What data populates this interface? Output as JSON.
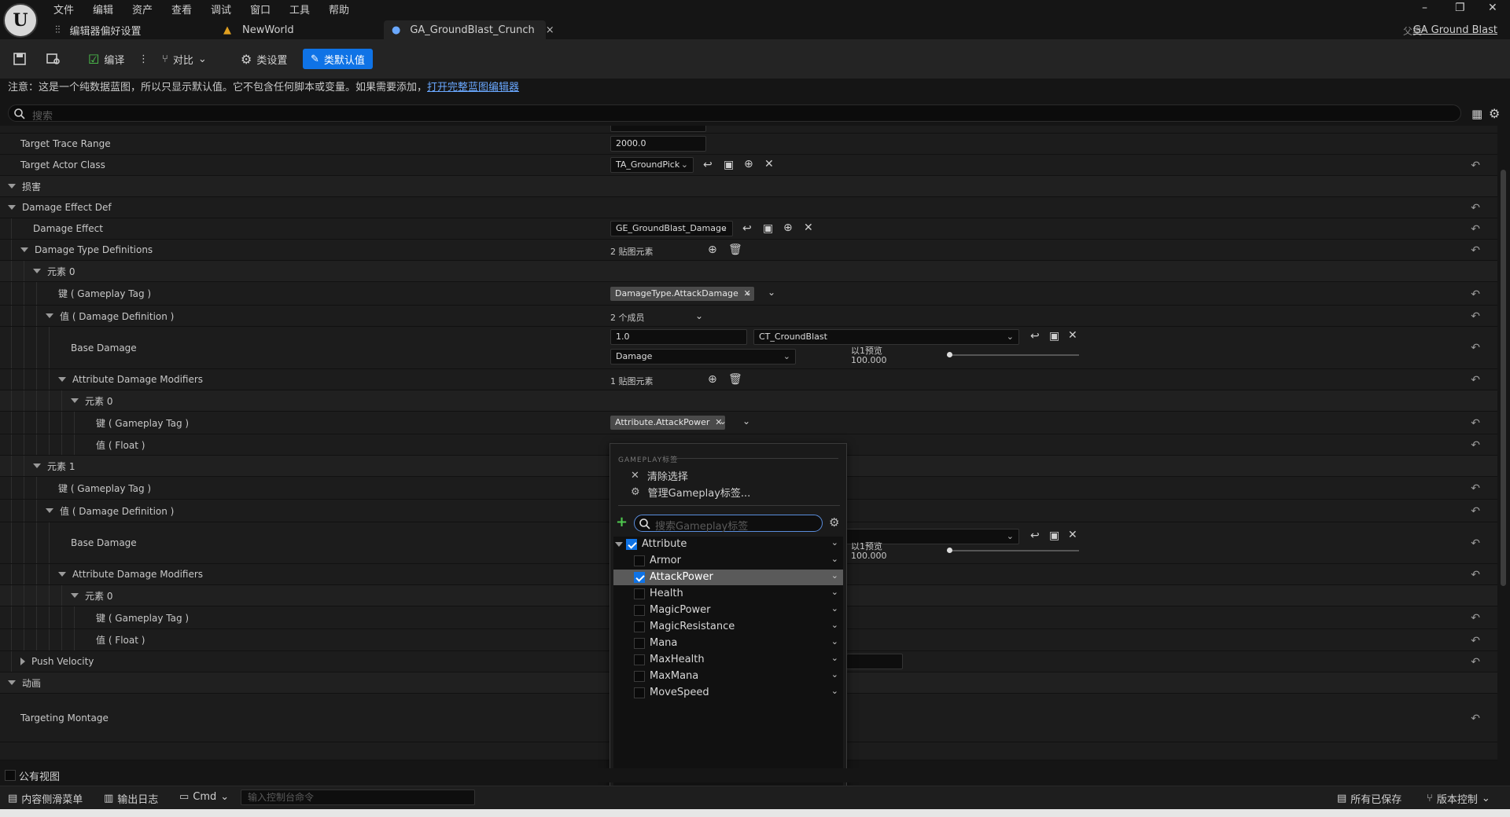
{
  "menu": [
    "文件",
    "编辑",
    "资产",
    "查看",
    "调试",
    "窗口",
    "工具",
    "帮助"
  ],
  "tabs": [
    {
      "label": "编辑器偏好设置"
    },
    {
      "label": "NewWorld"
    },
    {
      "label": "GA_GroundBlast_Crunch",
      "close": "×"
    }
  ],
  "parent": {
    "label": "父类：",
    "value": "GA Ground Blast"
  },
  "toolbar": {
    "compile": "编译",
    "diff": "对比",
    "class_settings": "类设置",
    "class_defaults": "类默认值"
  },
  "notice": {
    "text": "注意：这是一个纯数据蓝图，所以只显示默认值。它不包含任何脚本或变量。如果需要添加，",
    "link": "打开完整蓝图编辑器"
  },
  "search": {
    "placeholder": "搜索"
  },
  "details": {
    "target_trace_range": {
      "label": "Target Trace Range",
      "value": "2000.0"
    },
    "target_actor_class": {
      "label": "Target Actor Class",
      "value": "TA_GroundPick"
    },
    "cat_damage": "损害",
    "damage_effect_def": "Damage Effect Def",
    "damage_effect": {
      "label": "Damage Effect",
      "value": "GE_GroundBlast_Damage"
    },
    "damage_type_defs": {
      "label": "Damage Type Definitions",
      "value": "2 贴图元素"
    },
    "element0": "元素 0",
    "key_tag": "键 ( Gameplay Tag )",
    "key_tag_value0": "DamageType.AttackDamage",
    "val_damage_def": "值 ( Damage Definition )",
    "members": "2 个成员",
    "base_damage": {
      "label": "Base Damage",
      "value": "1.0",
      "curve_table": "CT_CroundBlast",
      "row": "Damage",
      "preview_label": "以1预览",
      "preview_value": "100.000"
    },
    "attr_damage_mods": {
      "label": "Attribute Damage Modifiers",
      "value": "1 贴图元素"
    },
    "sub_element0": "元素 0",
    "sub_key_tag_value": "Attribute.AttackPower",
    "val_float": "值 ( Float )",
    "element1": "元素 1",
    "base_damage2": {
      "label": "Base Damage",
      "preview_label": "以1预览",
      "preview_value": "100.000"
    },
    "push_velocity": "Push Velocity",
    "cat_animation": "动画",
    "targeting_montage": "Targeting Montage"
  },
  "popup": {
    "header": "GAMEPLAY标签",
    "clear": "清除选择",
    "manage": "管理Gameplay标签...",
    "search_placeholder": "搜索Gameplay标签",
    "tags": [
      {
        "name": "Attribute",
        "checked": true,
        "parent": true
      },
      {
        "name": "Armor",
        "checked": false
      },
      {
        "name": "AttackPower",
        "checked": true,
        "selected": true
      },
      {
        "name": "Health",
        "checked": false
      },
      {
        "name": "MagicPower",
        "checked": false
      },
      {
        "name": "MagicResistance",
        "checked": false
      },
      {
        "name": "Mana",
        "checked": false
      },
      {
        "name": "MaxHealth",
        "checked": false
      },
      {
        "name": "MaxMana",
        "checked": false
      },
      {
        "name": "MoveSpeed",
        "checked": false
      }
    ]
  },
  "bottom": {
    "public_view": "公有视图",
    "content_drawer": "内容侧滑菜单",
    "output_log": "输出日志",
    "cmd": "Cmd",
    "console_placeholder": "输入控制台命令",
    "all_saved": "所有已保存",
    "source_control": "版本控制"
  }
}
